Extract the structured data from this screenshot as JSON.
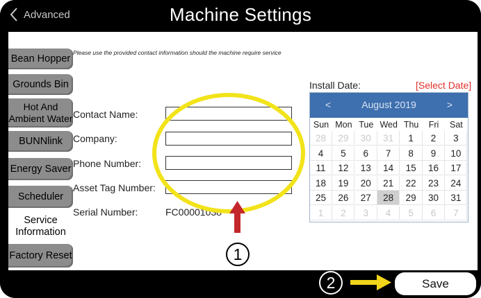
{
  "header": {
    "back_label": "Advanced",
    "title": "Machine Settings"
  },
  "sidebar": {
    "tabs": [
      {
        "label": "Bean Hopper"
      },
      {
        "label": "Grounds Bin"
      },
      {
        "label": "Hot And Ambient Water"
      },
      {
        "label": "BUNNlink"
      },
      {
        "label": "Energy Saver"
      },
      {
        "label": "Scheduler"
      },
      {
        "label": "Service Information",
        "active": true
      },
      {
        "label": "Factory Reset"
      }
    ]
  },
  "form": {
    "note": "Please use the provided contact information should the machine require service",
    "contact_name_label": "Contact Name:",
    "company_label": "Company:",
    "phone_label": "Phone Number:",
    "asset_tag_label": "Asset Tag Number:",
    "serial_label": "Serial Number:",
    "serial_value": "FC00001038",
    "contact_name_value": "",
    "company_value": "",
    "phone_value": "",
    "asset_tag_value": ""
  },
  "calendar": {
    "install_label": "Install Date:",
    "select_label": "[Select Date]",
    "month_label": "August 2019",
    "prev_label": "<",
    "next_label": ">",
    "weekdays": [
      "Sun",
      "Mon",
      "Tue",
      "Wed",
      "Thu",
      "Fri",
      "Sat"
    ],
    "weeks": [
      [
        "28",
        "29",
        "30",
        "31",
        "1",
        "2",
        "3"
      ],
      [
        "4",
        "5",
        "6",
        "7",
        "8",
        "9",
        "10"
      ],
      [
        "11",
        "12",
        "13",
        "14",
        "15",
        "16",
        "17"
      ],
      [
        "18",
        "19",
        "20",
        "21",
        "22",
        "23",
        "24"
      ],
      [
        "25",
        "26",
        "27",
        "28",
        "29",
        "30",
        "31"
      ],
      [
        "1",
        "2",
        "3",
        "4",
        "5",
        "6",
        "7"
      ]
    ],
    "highlighted_day": "28"
  },
  "footer": {
    "save_label": "Save"
  },
  "annotations": {
    "step1": "1",
    "step2": "2"
  },
  "colors": {
    "highlight_ellipse": "#f2e31a",
    "arrow_red": "#c3272b",
    "arrow_yellow": "#f2d41a",
    "calendar_header": "#3e6fae",
    "select_date": "#e0302a"
  }
}
